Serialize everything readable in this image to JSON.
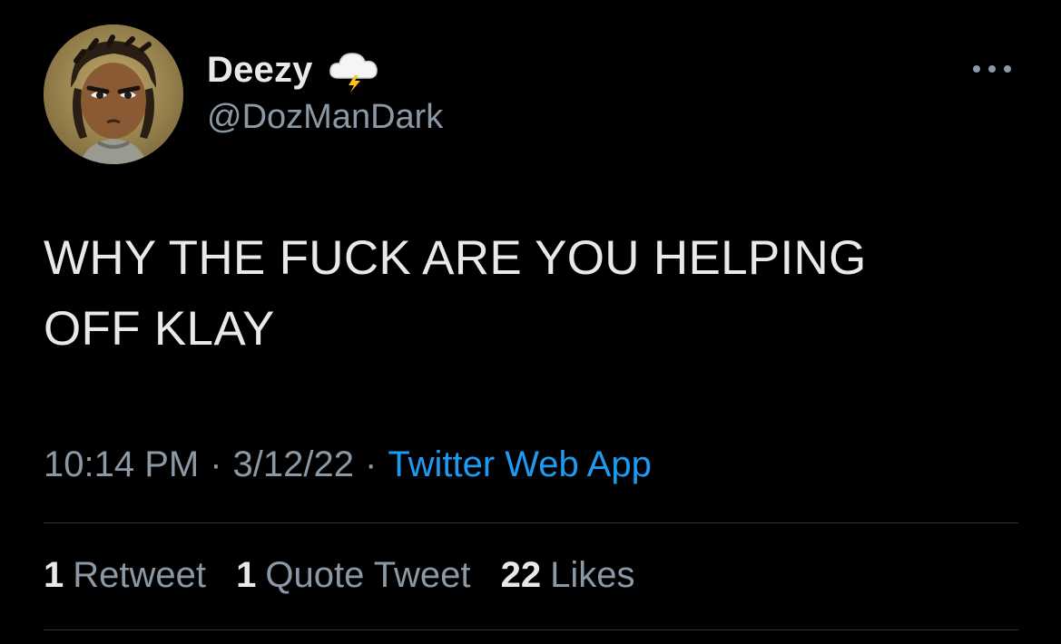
{
  "author": {
    "display_name": "Deezy",
    "handle": "@DozManDark",
    "name_emoji": "cloud-with-lightning-icon"
  },
  "tweet": {
    "text_line1": "WHY THE FUCK ARE YOU HELPING",
    "text_line2": "OFF KLAY"
  },
  "meta": {
    "time": "10:14 PM",
    "date": "3/12/22",
    "separator": "·",
    "source": "Twitter Web App"
  },
  "stats": {
    "retweets_count": "1",
    "retweets_label": "Retweet",
    "quotes_count": "1",
    "quotes_label": "Quote Tweet",
    "likes_count": "22",
    "likes_label": "Likes"
  },
  "colors": {
    "background": "#000000",
    "text_primary": "#e7e9ea",
    "text_secondary": "#8b98a5",
    "link": "#1d9bf0",
    "divider": "#2f3336"
  }
}
